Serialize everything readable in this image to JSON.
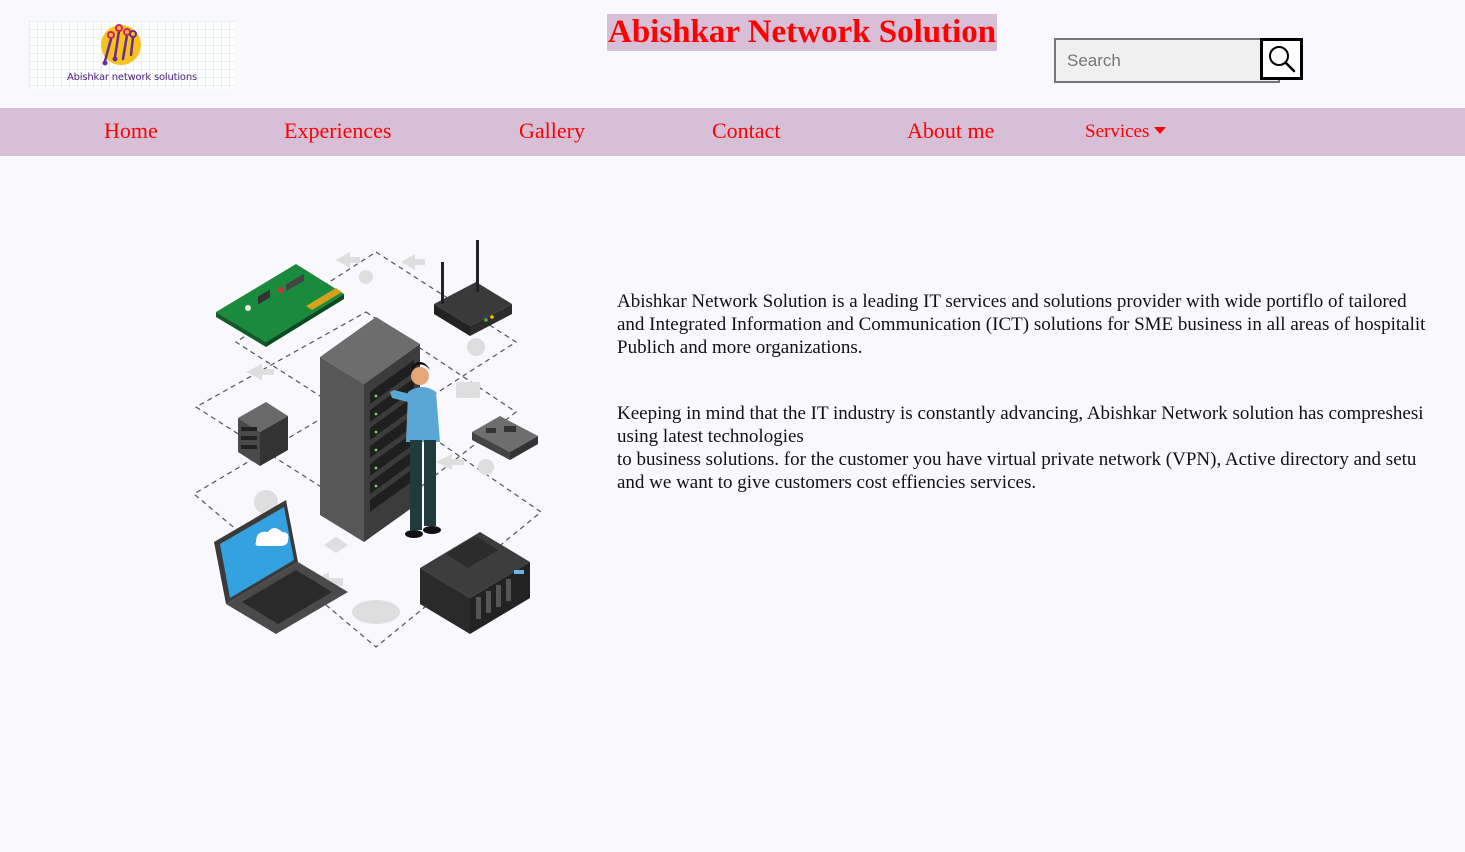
{
  "header": {
    "logo_text": "Abishkar network solutions",
    "site_title": "Abishkar Network Solution"
  },
  "search": {
    "placeholder": "Search",
    "button_icon": "search-icon"
  },
  "nav": {
    "items": [
      {
        "label": "Home"
      },
      {
        "label": "Experiences"
      },
      {
        "label": "Gallery"
      },
      {
        "label": "Contact"
      },
      {
        "label": "About me"
      }
    ],
    "services_label": "Services",
    "services_icon": "caret-down-icon"
  },
  "content": {
    "paragraph1": [
      "Abishkar Network Solution is a leading IT services and solutions provider with wide portiflo of tailored",
      "and Integrated Information and Communication (ICT) solutions for SME business in all areas of hospitalit",
      "Publich and more organizations."
    ],
    "paragraph2": [
      "Keeping in mind that the IT industry is constantly advancing, Abishkar Network solution has compreshesi",
      "using latest technologies",
      "to business solutions. for the customer you have virtual private network (VPN), Active directory and setu",
      "and we want to give customers cost effiencies services."
    ]
  },
  "colors": {
    "accent": "#ff0000",
    "nav_bg": "#d8bfd8",
    "page_bg": "#f8f8fd"
  }
}
